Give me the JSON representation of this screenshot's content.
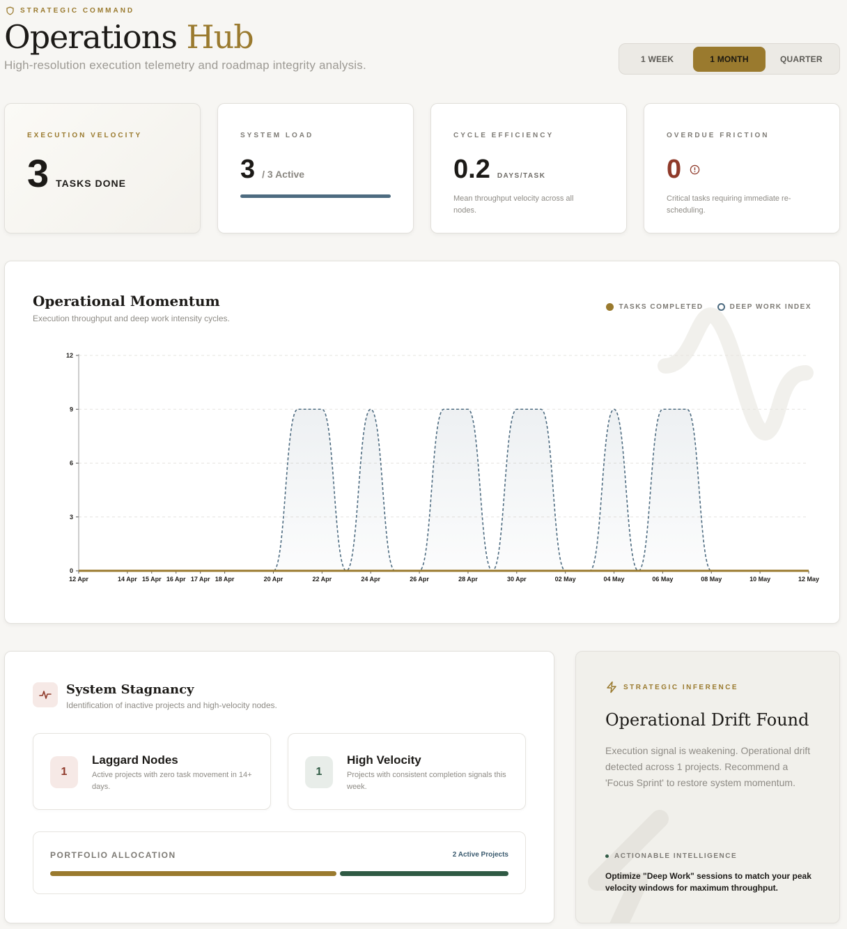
{
  "header": {
    "eyebrow": "STRATEGIC COMMAND",
    "title_main": "Operations",
    "title_accent": "Hub",
    "subtitle": "High-resolution execution telemetry and roadmap integrity analysis.",
    "range_options": [
      "1 WEEK",
      "1 MONTH",
      "QUARTER"
    ],
    "range_selected": "1 MONTH"
  },
  "kpis": {
    "velocity": {
      "label": "EXECUTION VELOCITY",
      "value": "3",
      "unit": "TASKS DONE"
    },
    "load": {
      "label": "SYSTEM LOAD",
      "value": "3",
      "unit": "/ 3 Active",
      "fill": 1.0
    },
    "efficiency": {
      "label": "CYCLE EFFICIENCY",
      "value": "0.2",
      "unit": "DAYS/TASK",
      "note": "Mean throughput velocity across all nodes."
    },
    "overdue": {
      "label": "OVERDUE FRICTION",
      "value": "0",
      "note": "Critical tasks requiring immediate re-scheduling."
    }
  },
  "chart": {
    "title": "Operational Momentum",
    "subtitle": "Execution throughput and deep work intensity cycles.",
    "legend": [
      "TASKS COMPLETED",
      "DEEP WORK INDEX"
    ]
  },
  "chart_data": {
    "type": "line",
    "x": [
      "12 Apr",
      "13 Apr",
      "14 Apr",
      "15 Apr",
      "16 Apr",
      "17 Apr",
      "18 Apr",
      "19 Apr",
      "20 Apr",
      "21 Apr",
      "22 Apr",
      "23 Apr",
      "24 Apr",
      "25 Apr",
      "26 Apr",
      "27 Apr",
      "28 Apr",
      "29 Apr",
      "30 Apr",
      "01 May",
      "02 May",
      "03 May",
      "04 May",
      "05 May",
      "06 May",
      "07 May",
      "08 May",
      "09 May",
      "10 May",
      "11 May",
      "12 May"
    ],
    "tick_labels": [
      "12 Apr",
      "14 Apr",
      "15 Apr",
      "16 Apr",
      "17 Apr",
      "18 Apr",
      "20 Apr",
      "22 Apr",
      "24 Apr",
      "26 Apr",
      "28 Apr",
      "30 Apr",
      "02 May",
      "04 May",
      "06 May",
      "08 May",
      "10 May",
      "12 May"
    ],
    "series": [
      {
        "name": "TASKS COMPLETED",
        "color": "#9a7a2e",
        "values": [
          0,
          0,
          0,
          0,
          0,
          0,
          0,
          0,
          0,
          0,
          0,
          0,
          0,
          0,
          0,
          0,
          0,
          0,
          0,
          0,
          0,
          0,
          0,
          0,
          0,
          0,
          0,
          0,
          0,
          0,
          0
        ]
      },
      {
        "name": "DEEP WORK INDEX",
        "color": "#4d6b80",
        "values": [
          0,
          0,
          0,
          0,
          0,
          0,
          0,
          0,
          0,
          9,
          9,
          0,
          9,
          0,
          0,
          9,
          9,
          0,
          9,
          9,
          0,
          0,
          9,
          0,
          9,
          9,
          0,
          0,
          0,
          0,
          0
        ]
      }
    ],
    "yticks": [
      0,
      3,
      6,
      9,
      12
    ],
    "ylim": [
      0,
      12
    ],
    "grid": true,
    "legend_position": "top-right"
  },
  "stagnancy": {
    "title": "System Stagnancy",
    "subtitle": "Identification of inactive projects and high-velocity nodes.",
    "laggard": {
      "count": "1",
      "title": "Laggard Nodes",
      "desc": "Active projects with zero task movement in 14+ days."
    },
    "velocity": {
      "count": "1",
      "title": "High Velocity",
      "desc": "Projects with consistent completion signals this week."
    },
    "allocation": {
      "label": "PORTFOLIO ALLOCATION",
      "count": "2 Active Projects",
      "segments": [
        {
          "share": 0.63,
          "color": "#9a7a2e"
        },
        {
          "share": 0.37,
          "color": "#2f5a44"
        }
      ]
    }
  },
  "inference": {
    "eyebrow": "STRATEGIC INFERENCE",
    "title": "Operational Drift Found",
    "text": "Execution signal is weakening. Operational drift detected across 1 projects. Recommend a 'Focus Sprint' to restore system momentum.",
    "section": "ACTIONABLE INTELLIGENCE",
    "action": "Optimize \"Deep Work\" sessions to match your peak velocity windows for maximum throughput."
  }
}
